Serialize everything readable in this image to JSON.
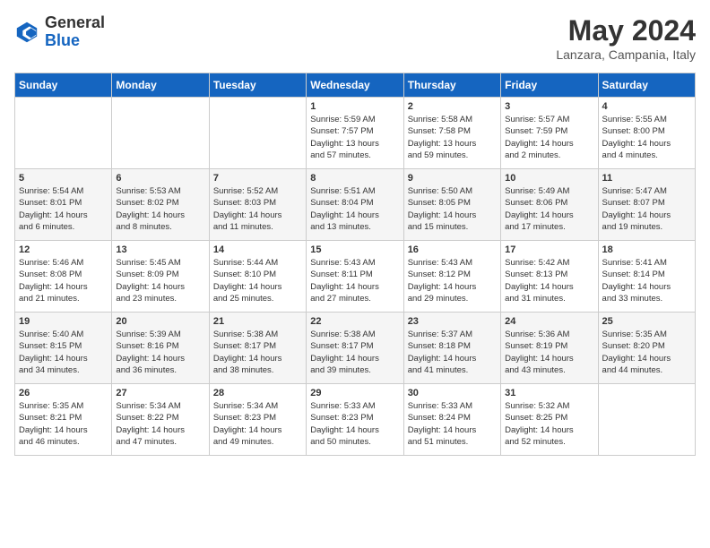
{
  "logo": {
    "general": "General",
    "blue": "Blue"
  },
  "calendar": {
    "title": "May 2024",
    "subtitle": "Lanzara, Campania, Italy"
  },
  "weekdays": [
    "Sunday",
    "Monday",
    "Tuesday",
    "Wednesday",
    "Thursday",
    "Friday",
    "Saturday"
  ],
  "weeks": [
    [
      {
        "day": "",
        "info": ""
      },
      {
        "day": "",
        "info": ""
      },
      {
        "day": "",
        "info": ""
      },
      {
        "day": "1",
        "info": "Sunrise: 5:59 AM\nSunset: 7:57 PM\nDaylight: 13 hours\nand 57 minutes."
      },
      {
        "day": "2",
        "info": "Sunrise: 5:58 AM\nSunset: 7:58 PM\nDaylight: 13 hours\nand 59 minutes."
      },
      {
        "day": "3",
        "info": "Sunrise: 5:57 AM\nSunset: 7:59 PM\nDaylight: 14 hours\nand 2 minutes."
      },
      {
        "day": "4",
        "info": "Sunrise: 5:55 AM\nSunset: 8:00 PM\nDaylight: 14 hours\nand 4 minutes."
      }
    ],
    [
      {
        "day": "5",
        "info": "Sunrise: 5:54 AM\nSunset: 8:01 PM\nDaylight: 14 hours\nand 6 minutes."
      },
      {
        "day": "6",
        "info": "Sunrise: 5:53 AM\nSunset: 8:02 PM\nDaylight: 14 hours\nand 8 minutes."
      },
      {
        "day": "7",
        "info": "Sunrise: 5:52 AM\nSunset: 8:03 PM\nDaylight: 14 hours\nand 11 minutes."
      },
      {
        "day": "8",
        "info": "Sunrise: 5:51 AM\nSunset: 8:04 PM\nDaylight: 14 hours\nand 13 minutes."
      },
      {
        "day": "9",
        "info": "Sunrise: 5:50 AM\nSunset: 8:05 PM\nDaylight: 14 hours\nand 15 minutes."
      },
      {
        "day": "10",
        "info": "Sunrise: 5:49 AM\nSunset: 8:06 PM\nDaylight: 14 hours\nand 17 minutes."
      },
      {
        "day": "11",
        "info": "Sunrise: 5:47 AM\nSunset: 8:07 PM\nDaylight: 14 hours\nand 19 minutes."
      }
    ],
    [
      {
        "day": "12",
        "info": "Sunrise: 5:46 AM\nSunset: 8:08 PM\nDaylight: 14 hours\nand 21 minutes."
      },
      {
        "day": "13",
        "info": "Sunrise: 5:45 AM\nSunset: 8:09 PM\nDaylight: 14 hours\nand 23 minutes."
      },
      {
        "day": "14",
        "info": "Sunrise: 5:44 AM\nSunset: 8:10 PM\nDaylight: 14 hours\nand 25 minutes."
      },
      {
        "day": "15",
        "info": "Sunrise: 5:43 AM\nSunset: 8:11 PM\nDaylight: 14 hours\nand 27 minutes."
      },
      {
        "day": "16",
        "info": "Sunrise: 5:43 AM\nSunset: 8:12 PM\nDaylight: 14 hours\nand 29 minutes."
      },
      {
        "day": "17",
        "info": "Sunrise: 5:42 AM\nSunset: 8:13 PM\nDaylight: 14 hours\nand 31 minutes."
      },
      {
        "day": "18",
        "info": "Sunrise: 5:41 AM\nSunset: 8:14 PM\nDaylight: 14 hours\nand 33 minutes."
      }
    ],
    [
      {
        "day": "19",
        "info": "Sunrise: 5:40 AM\nSunset: 8:15 PM\nDaylight: 14 hours\nand 34 minutes."
      },
      {
        "day": "20",
        "info": "Sunrise: 5:39 AM\nSunset: 8:16 PM\nDaylight: 14 hours\nand 36 minutes."
      },
      {
        "day": "21",
        "info": "Sunrise: 5:38 AM\nSunset: 8:17 PM\nDaylight: 14 hours\nand 38 minutes."
      },
      {
        "day": "22",
        "info": "Sunrise: 5:38 AM\nSunset: 8:17 PM\nDaylight: 14 hours\nand 39 minutes."
      },
      {
        "day": "23",
        "info": "Sunrise: 5:37 AM\nSunset: 8:18 PM\nDaylight: 14 hours\nand 41 minutes."
      },
      {
        "day": "24",
        "info": "Sunrise: 5:36 AM\nSunset: 8:19 PM\nDaylight: 14 hours\nand 43 minutes."
      },
      {
        "day": "25",
        "info": "Sunrise: 5:35 AM\nSunset: 8:20 PM\nDaylight: 14 hours\nand 44 minutes."
      }
    ],
    [
      {
        "day": "26",
        "info": "Sunrise: 5:35 AM\nSunset: 8:21 PM\nDaylight: 14 hours\nand 46 minutes."
      },
      {
        "day": "27",
        "info": "Sunrise: 5:34 AM\nSunset: 8:22 PM\nDaylight: 14 hours\nand 47 minutes."
      },
      {
        "day": "28",
        "info": "Sunrise: 5:34 AM\nSunset: 8:23 PM\nDaylight: 14 hours\nand 49 minutes."
      },
      {
        "day": "29",
        "info": "Sunrise: 5:33 AM\nSunset: 8:23 PM\nDaylight: 14 hours\nand 50 minutes."
      },
      {
        "day": "30",
        "info": "Sunrise: 5:33 AM\nSunset: 8:24 PM\nDaylight: 14 hours\nand 51 minutes."
      },
      {
        "day": "31",
        "info": "Sunrise: 5:32 AM\nSunset: 8:25 PM\nDaylight: 14 hours\nand 52 minutes."
      },
      {
        "day": "",
        "info": ""
      }
    ]
  ]
}
